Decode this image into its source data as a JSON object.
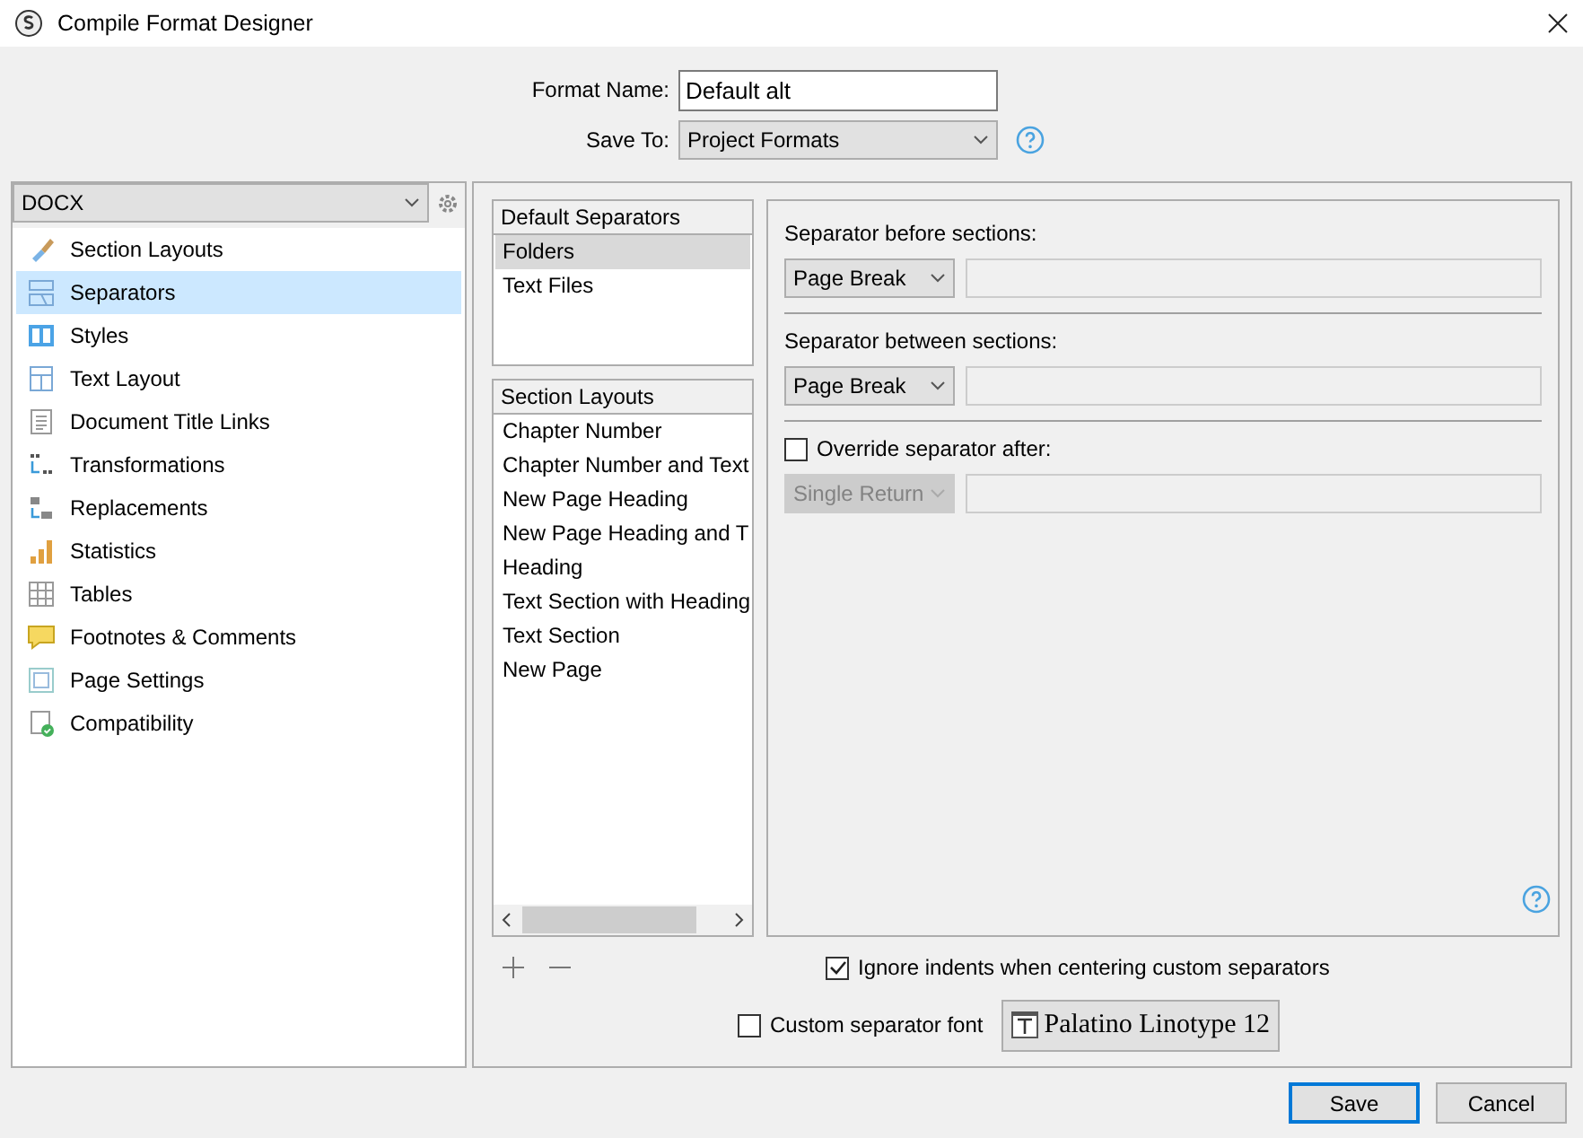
{
  "window": {
    "title": "Compile Format Designer"
  },
  "format_name": {
    "label": "Format Name:",
    "value": "Default alt"
  },
  "save_to": {
    "label": "Save To:",
    "value": "Project Formats"
  },
  "format_select": {
    "value": "DOCX"
  },
  "sidebar": {
    "items": [
      {
        "label": "Section Layouts",
        "selected": false
      },
      {
        "label": "Separators",
        "selected": true
      },
      {
        "label": "Styles",
        "selected": false
      },
      {
        "label": "Text Layout",
        "selected": false
      },
      {
        "label": "Document Title Links",
        "selected": false
      },
      {
        "label": "Transformations",
        "selected": false
      },
      {
        "label": "Replacements",
        "selected": false
      },
      {
        "label": "Statistics",
        "selected": false
      },
      {
        "label": "Tables",
        "selected": false
      },
      {
        "label": "Footnotes & Comments",
        "selected": false
      },
      {
        "label": "Page Settings",
        "selected": false
      },
      {
        "label": "Compatibility",
        "selected": false
      }
    ]
  },
  "default_separators": {
    "title": "Default Separators",
    "items": [
      {
        "label": "Folders",
        "selected": true
      },
      {
        "label": "Text Files",
        "selected": false
      }
    ]
  },
  "section_layouts": {
    "title": "Section Layouts",
    "items": [
      {
        "label": "Chapter Number",
        "selected": false
      },
      {
        "label": "Chapter Number and Text",
        "selected": false
      },
      {
        "label": "New Page Heading",
        "selected": false
      },
      {
        "label": "New Page Heading and T",
        "selected": false
      },
      {
        "label": "Heading",
        "selected": false
      },
      {
        "label": "Text Section with Heading",
        "selected": false
      },
      {
        "label": "Text Section",
        "selected": false
      },
      {
        "label": "New Page",
        "selected": false
      }
    ]
  },
  "separators": [
    {
      "kind": "label",
      "label": "Separator before sections:",
      "value": "Page Break",
      "disabled": false
    },
    {
      "kind": "label",
      "label": "Separator between sections:",
      "value": "Page Break",
      "disabled": false
    },
    {
      "kind": "checkbox",
      "label": "Override separator after:",
      "checked": false,
      "value": "Single Return",
      "disabled": true
    }
  ],
  "ignore_indents": {
    "label": "Ignore indents when centering custom separators",
    "checked": true
  },
  "custom_font": {
    "label": "Custom separator font",
    "checked": false,
    "font": "Palatino Linotype 12"
  },
  "buttons": [
    {
      "label": "Save",
      "default": true
    },
    {
      "label": "Cancel",
      "default": false
    }
  ]
}
